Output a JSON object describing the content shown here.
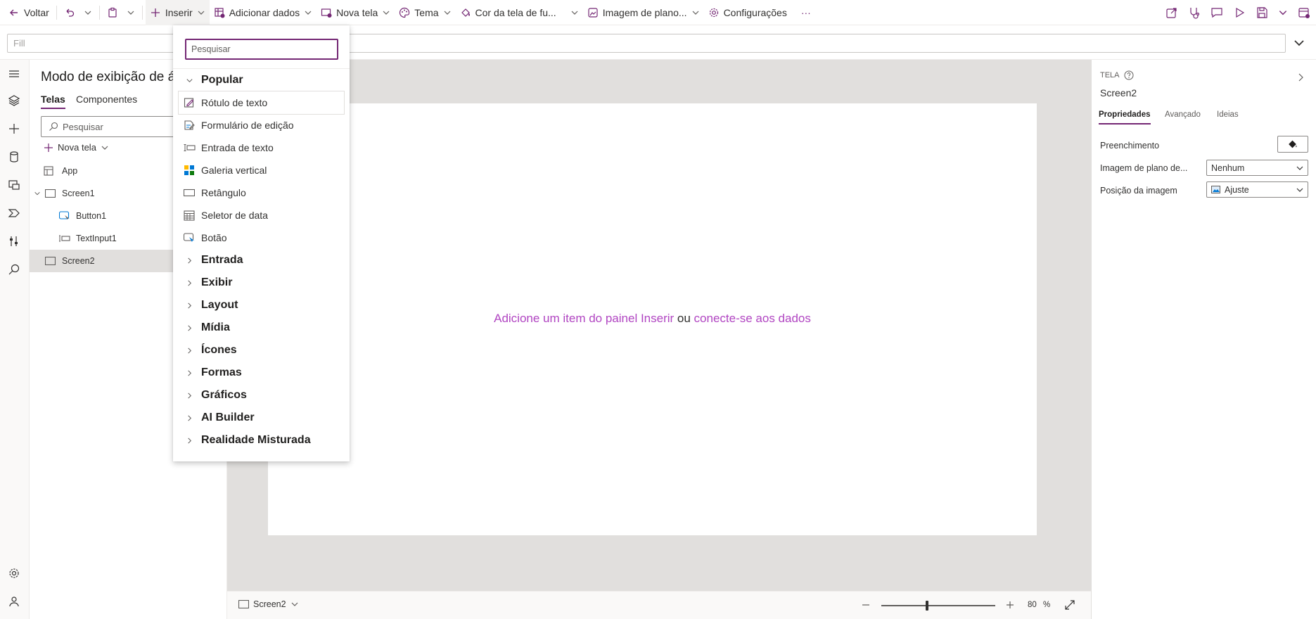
{
  "toolbar": {
    "back_label": "Voltar",
    "insert_label": "Inserir",
    "add_data_label": "Adicionar dados",
    "new_screen_label": "Nova tela",
    "theme_label": "Tema",
    "bg_color_label": "Cor da tela de fu...",
    "bg_image_label": "Imagem de plano...",
    "settings_label": "Configurações",
    "more_label": "···"
  },
  "formula_bar": {
    "property_value": "Fill"
  },
  "tree_view": {
    "title": "Modo de exibição de árvore",
    "tabs": [
      "Telas",
      "Componentes"
    ],
    "search_placeholder": "Pesquisar",
    "new_screen_label": "Nova tela",
    "items": [
      {
        "label": "App"
      },
      {
        "label": "Screen1"
      },
      {
        "label": "Button1"
      },
      {
        "label": "TextInput1"
      },
      {
        "label": "Screen2"
      }
    ]
  },
  "insert_menu": {
    "search_placeholder": "Pesquisar",
    "popular_label": "Popular",
    "popular_items": [
      {
        "label": "Rótulo de texto",
        "icon": "text-label-icon"
      },
      {
        "label": "Formulário de edição",
        "icon": "edit-form-icon"
      },
      {
        "label": "Entrada de texto",
        "icon": "text-input-icon"
      },
      {
        "label": "Galeria vertical",
        "icon": "gallery-icon"
      },
      {
        "label": "Retângulo",
        "icon": "rectangle-icon"
      },
      {
        "label": "Seletor de data",
        "icon": "calendar-icon"
      },
      {
        "label": "Botão",
        "icon": "button-icon"
      }
    ],
    "categories": [
      "Entrada",
      "Exibir",
      "Layout",
      "Mídia",
      "Ícones",
      "Formas",
      "Gráficos",
      "AI Builder",
      "Realidade Misturada"
    ]
  },
  "canvas": {
    "message_part1": "Adicione um item do painel Inserir",
    "message_or": " ou ",
    "message_part2": "conecte-se aos dados",
    "link_color": "#b146c2"
  },
  "bottom_bar": {
    "screen_name": "Screen2",
    "zoom_value": "80",
    "zoom_unit": "%",
    "zoom_level": 0.4
  },
  "properties": {
    "section_label": "TELA",
    "screen_name": "Screen2",
    "tabs": [
      "Propriedades",
      "Avançado",
      "Ideias"
    ],
    "fill_label": "Preenchimento",
    "bg_image_label": "Imagem de plano de...",
    "bg_image_value": "Nenhum",
    "image_position_label": "Posição da imagem",
    "image_position_value": "Ajuste"
  },
  "colors": {
    "accent": "#742774",
    "link": "#b146c2"
  }
}
